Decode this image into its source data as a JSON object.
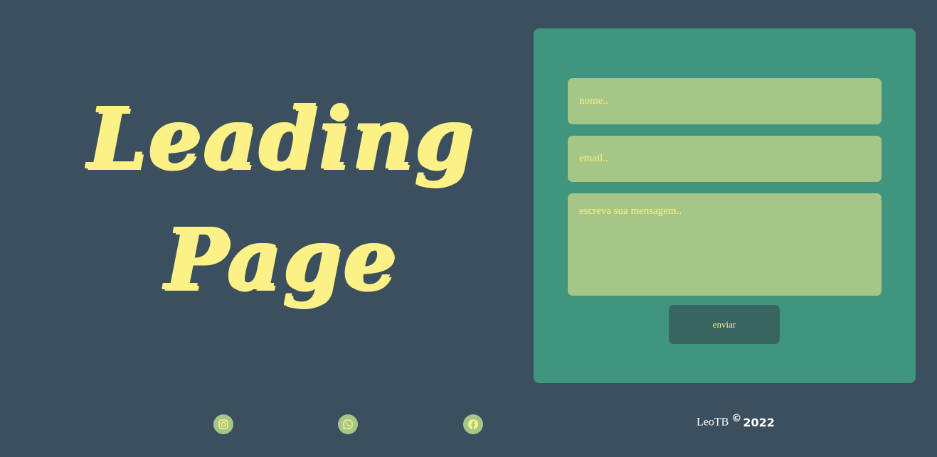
{
  "hero": {
    "line1": "Leading",
    "line2": "Page"
  },
  "form": {
    "name_placeholder": "nome..",
    "email_placeholder": "email..",
    "message_placeholder": "escreva sua mensagem..",
    "submit_label": "enviar"
  },
  "footer": {
    "social_icons": [
      "instagram-icon",
      "whatsapp-icon",
      "facebook-icon"
    ],
    "author": "LeoTB",
    "copyright_symbol": "©",
    "year": "2022"
  },
  "colors": {
    "background": "#3c4f5e",
    "accent_yellow": "#fcf186",
    "form_card": "#40957e",
    "field": "#a6c687",
    "button": "#396561"
  }
}
